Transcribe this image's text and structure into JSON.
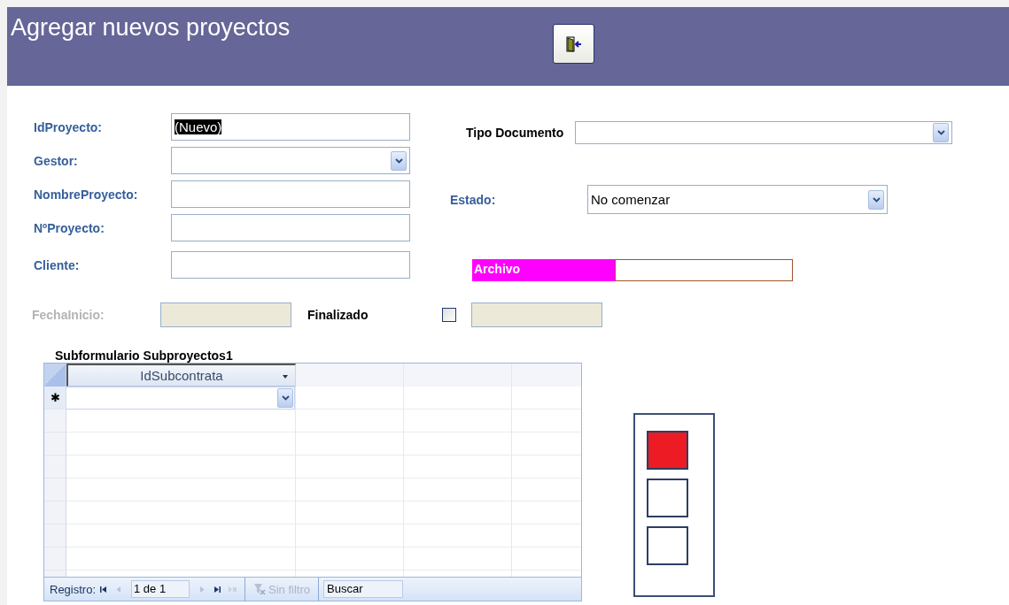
{
  "header": {
    "title": "Agregar nuevos proyectos"
  },
  "fields": [
    {
      "label": "IdProyecto:",
      "kind": "text",
      "value": "(Nuevo)",
      "selected": true
    },
    {
      "label": "Gestor:",
      "kind": "combo"
    },
    {
      "label": "NombreProyecto:",
      "kind": "text"
    },
    {
      "label": "NºProyecto:",
      "kind": "text"
    },
    {
      "label": "Cliente:",
      "kind": "text"
    }
  ],
  "tipo_documento": {
    "label": "Tipo Documento"
  },
  "estado": {
    "label": "Estado:",
    "value": "No comenzar"
  },
  "archivo": {
    "label": "Archivo"
  },
  "fecha_inicio": {
    "label": "FechaInicio:",
    "disabled": true
  },
  "finalizado": {
    "label": "Finalizado",
    "checked": false
  },
  "subform": {
    "title": "Subformulario Subproyectos1",
    "columns": [
      "IdSubcontrata"
    ],
    "new_row_marker": "✱",
    "navigator": {
      "label": "Registro:",
      "position": "1 de 1",
      "filter": "Sin filtro",
      "search": "Buscar"
    }
  },
  "lights": [
    {
      "on": true
    },
    {
      "on": false
    },
    {
      "on": false
    }
  ]
}
